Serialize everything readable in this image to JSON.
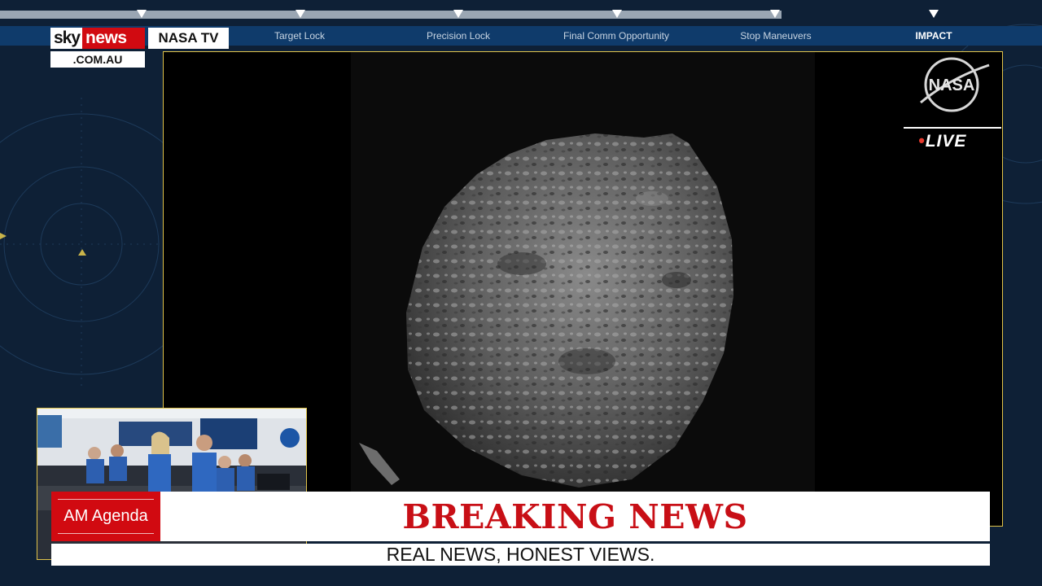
{
  "timeline": {
    "milestones": [
      {
        "label": ""
      },
      {
        "label": "Target Lock"
      },
      {
        "label": "Precision Lock"
      },
      {
        "label": "Final Comm Opportunity"
      },
      {
        "label": "Stop Maneuvers"
      },
      {
        "label": "IMPACT"
      }
    ]
  },
  "branding": {
    "sky": "sky",
    "news": "news",
    "domain": ".COM.AU",
    "source_badge": "NASA TV"
  },
  "video": {
    "live_label": "LIVE",
    "logo_text": "NASA"
  },
  "lower_third": {
    "program": "AM Agenda",
    "headline": "BREAKING NEWS",
    "ticker": "REAL NEWS, HONEST VIEWS."
  },
  "colors": {
    "sky_red": "#d10a11",
    "headline_red": "#c80f16",
    "timeline_blue": "#0f3b6b",
    "frame_gold": "#e0c34a"
  }
}
